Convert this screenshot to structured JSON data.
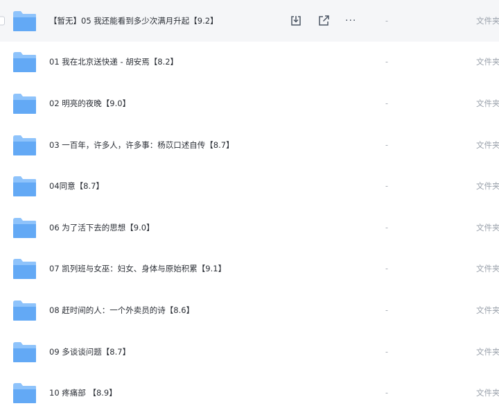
{
  "files": [
    {
      "name": "【暂无】05 我还能看到多少次满月升起【9.2】",
      "size": "-",
      "type": "文件夹"
    },
    {
      "name": "01 我在北京送快递 - 胡安焉【8.2】",
      "size": "-",
      "type": "文件夹"
    },
    {
      "name": "02 明亮的夜晚【9.0】",
      "size": "-",
      "type": "文件夹"
    },
    {
      "name": "03 一百年，许多人，许多事：杨苡口述自传【8.7】",
      "size": "-",
      "type": "文件夹"
    },
    {
      "name": "04同意【8.7】",
      "size": "-",
      "type": "文件夹"
    },
    {
      "name": "06 为了活下去的思想【9.0】",
      "size": "-",
      "type": "文件夹"
    },
    {
      "name": "07 凯列班与女巫：妇女、身体与原始积累【9.1】",
      "size": "-",
      "type": "文件夹"
    },
    {
      "name": "08 赶时间的人：一个外卖员的诗【8.6】",
      "size": "-",
      "type": "文件夹"
    },
    {
      "name": "09 多谈谈问题【8.7】",
      "size": "-",
      "type": "文件夹"
    },
    {
      "name": "10 疼痛部 【8.9】",
      "size": "-",
      "type": "文件夹"
    }
  ],
  "row_actions": {
    "download_icon": "download-icon",
    "share_icon": "share-icon",
    "more_icon": "more-icon",
    "more_label": "···"
  },
  "colors": {
    "folder_body": "#63a9f5",
    "folder_tab": "#8ec3fb",
    "hover_row": "#f5f6f8",
    "muted_text": "#9aa1ab"
  }
}
